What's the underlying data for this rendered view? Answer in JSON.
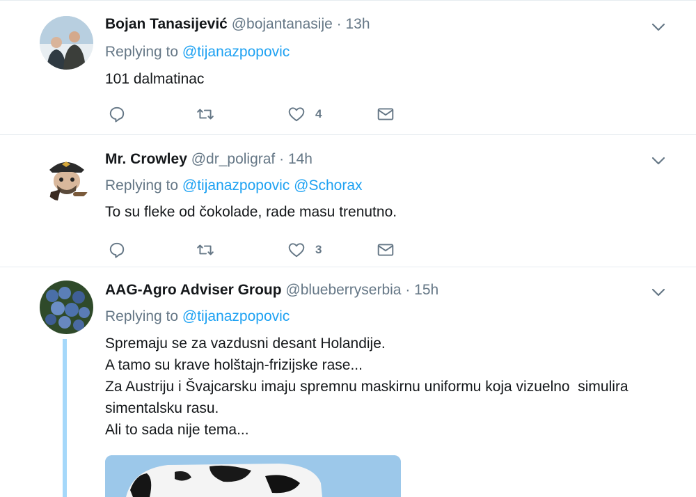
{
  "tweets": [
    {
      "name": "Bojan Tanasijević",
      "handle": "@bojantanasije",
      "dot": "·",
      "time": "13h",
      "replying_prefix": "Replying to",
      "mentions": "@tijanazpopovic",
      "text": "101 dalmatinac",
      "likes": "4"
    },
    {
      "name": "Mr. Crowley",
      "handle": "@dr_poligraf",
      "dot": "·",
      "time": "14h",
      "replying_prefix": "Replying to",
      "mentions": "@tijanazpopovic @Schorax",
      "text": "To su fleke od čokolade, rade masu trenutno.",
      "likes": "3"
    },
    {
      "name": "AAG-Agro Adviser Group",
      "handle": "@blueberryserbia",
      "dot": "·",
      "time": "15h",
      "replying_prefix": "Replying to",
      "mentions": "@tijanazpopovic",
      "lines": [
        "Spremaju se za vazdusni desant Holandije.",
        "A tamo su krave holštajn-frizijske rase...",
        "Za Austriju i Švajcarsku imaju spremnu maskirnu uniformu koja vizuelno  simulira",
        "simentalsku rasu.",
        "Ali to sada nije tema..."
      ]
    }
  ],
  "icons": {
    "reply": "reply-icon",
    "retweet": "retweet-icon",
    "like": "heart-icon",
    "dm": "envelope-icon",
    "caret": "chevron-down-icon"
  },
  "colors": {
    "link": "#1da1f2",
    "muted": "#657786",
    "text": "#14171a",
    "thread_line": "#a5d8fa"
  }
}
